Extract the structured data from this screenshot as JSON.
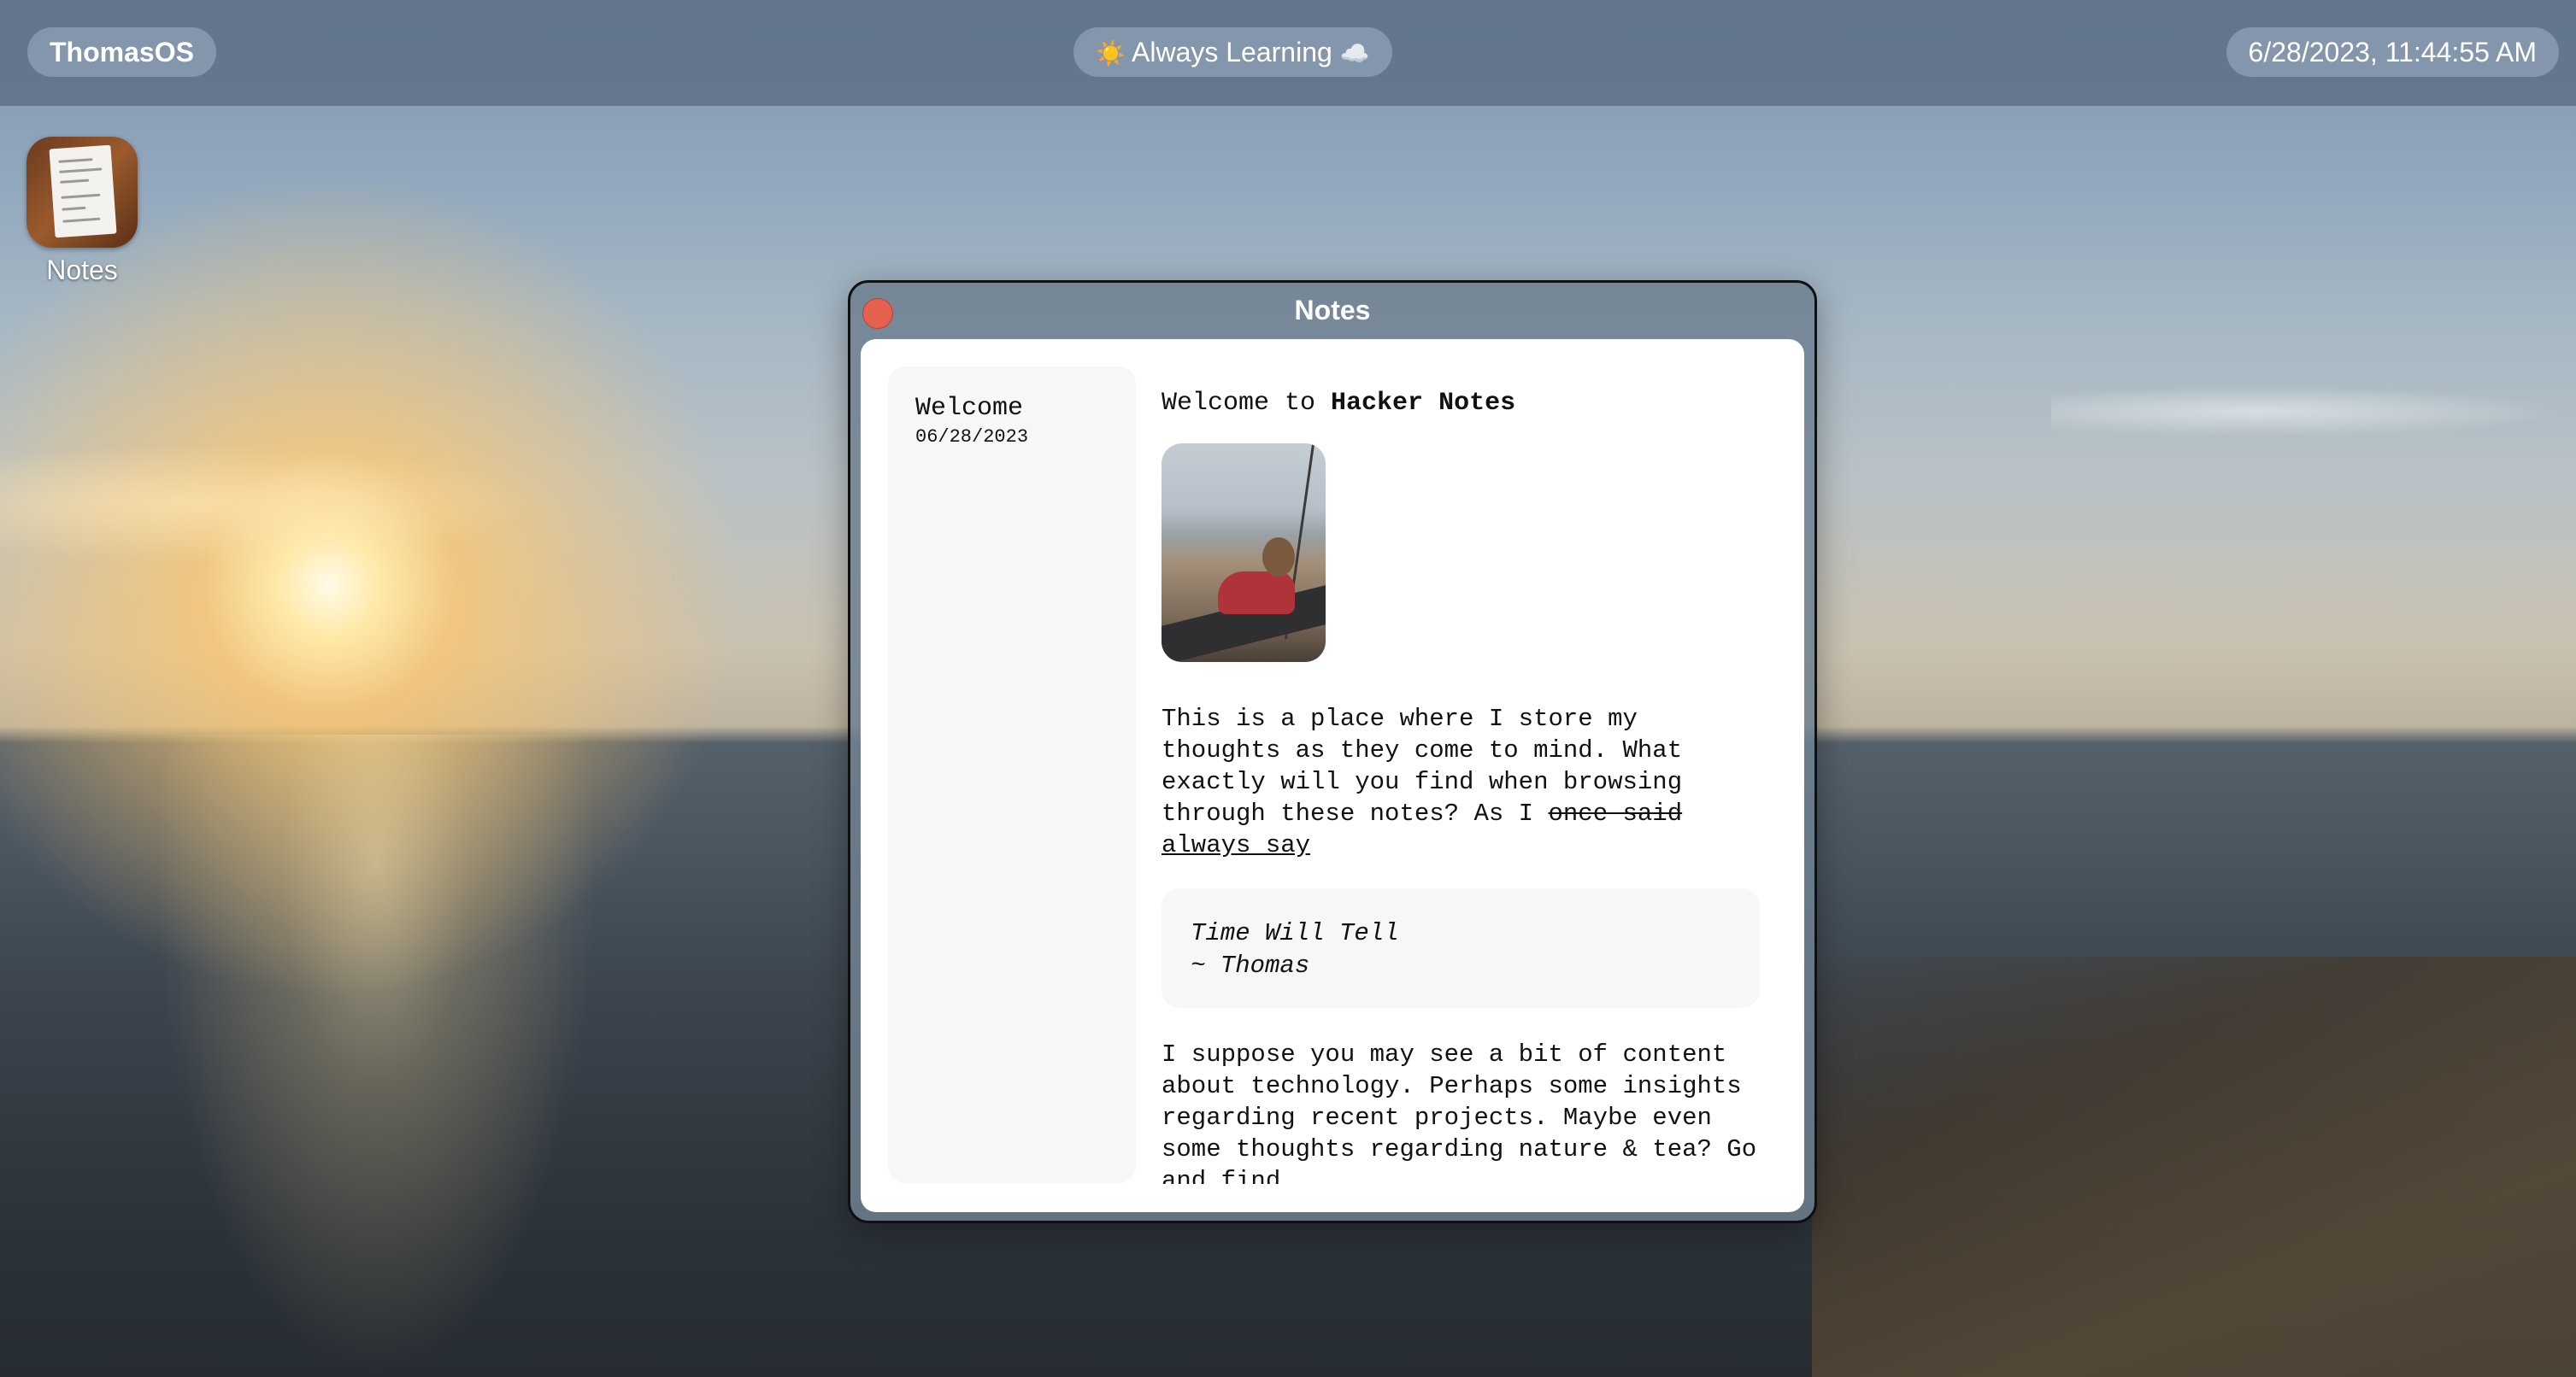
{
  "menubar": {
    "os_title": "ThomasOS",
    "center_text": "Always Learning",
    "center_left_icon": "sun-icon",
    "center_right_icon": "cloud-icon",
    "clock": "6/28/2023, 11:44:55 AM"
  },
  "desktop": {
    "icons": [
      {
        "label": "Notes",
        "icon": "notes-app-icon"
      }
    ]
  },
  "window": {
    "title": "Notes",
    "close_color": "#e5604f",
    "sidebar": {
      "notes": [
        {
          "title": "Welcome",
          "date": "06/28/2023"
        }
      ]
    },
    "note": {
      "heading_prefix": "Welcome to ",
      "heading_bold": "Hacker Notes",
      "para1_main": "This is a place where I store my thoughts as they come to mind. What exactly will you find when browsing through these notes? As I ",
      "para1_struck": "once said",
      "para1_underlined": "always say",
      "quote_line1": "Time Will Tell",
      "quote_line2": "~ Thomas",
      "para2": "I suppose you may see a bit of content about technology. Perhaps some insights regarding recent projects. Maybe even some thoughts regarding nature & tea? Go and find"
    }
  }
}
